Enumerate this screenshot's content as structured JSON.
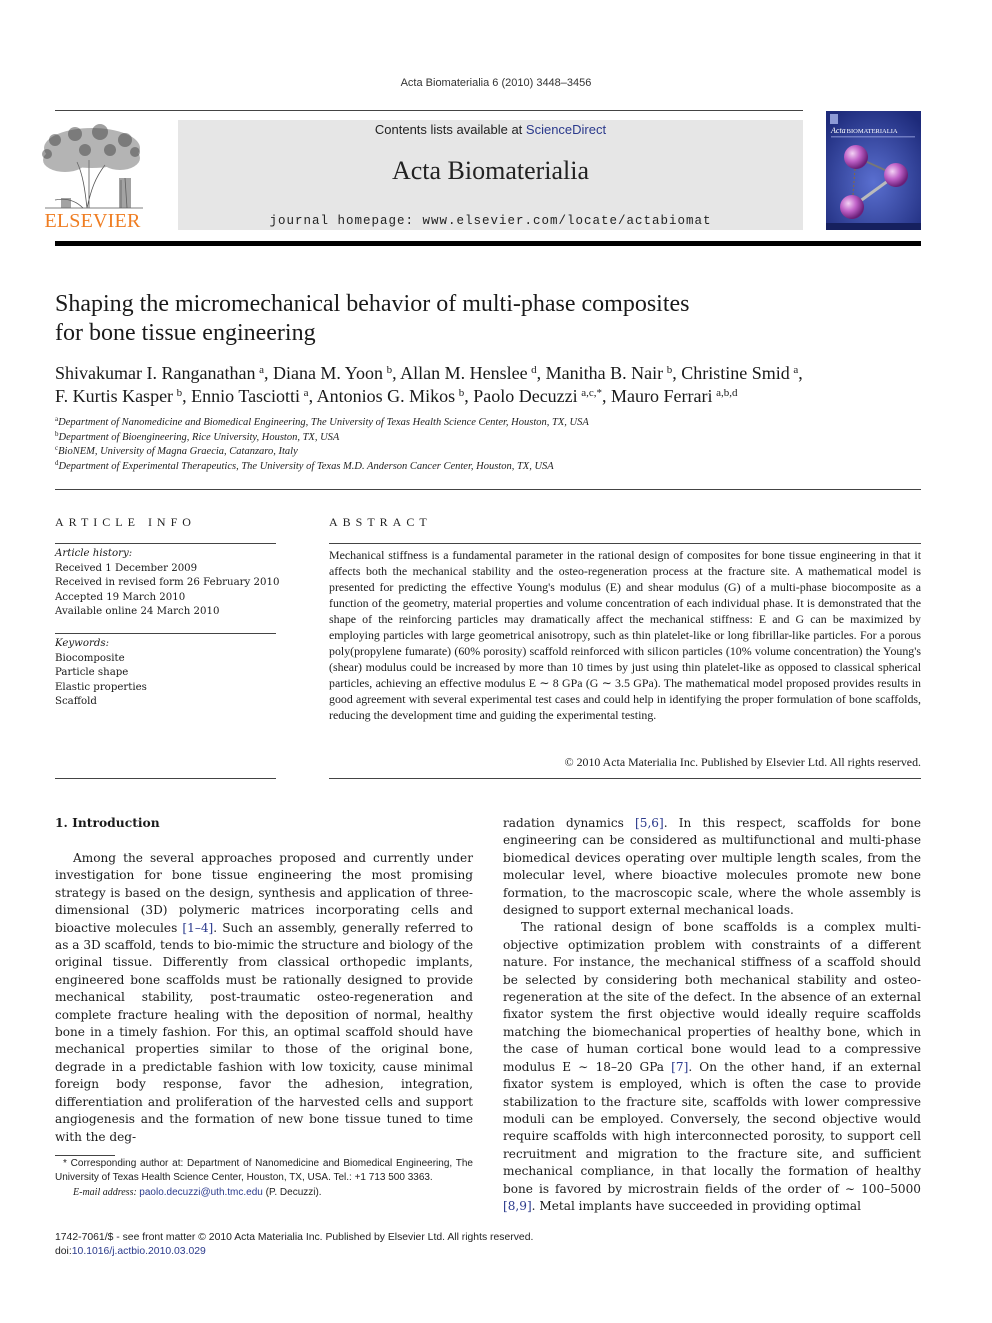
{
  "journal_ref": "Acta Biomaterialia 6 (2010) 3448–3456",
  "masthead": {
    "contents_prefix": "Contents lists available at ",
    "contents_link": "ScienceDirect",
    "journal_title": "Acta Biomaterialia",
    "homepage": "journal homepage: www.elsevier.com/locate/actabiomat",
    "publisher_wordmark": "ELSEVIER",
    "cover_title_a": "Acta",
    "cover_title_b": "BIOMATERIALIA",
    "brand_color": "#ef7d22",
    "link_color": "#2b3a8c"
  },
  "article": {
    "title_line1": "Shaping the micromechanical behavior of multi-phase composites",
    "title_line2": "for bone tissue engineering",
    "authors": [
      {
        "name": "Shivakumar I. Ranganathan",
        "aff": "a",
        "sep": ", "
      },
      {
        "name": "Diana M. Yoon",
        "aff": "b",
        "sep": ", "
      },
      {
        "name": "Allan M. Henslee",
        "aff": "d",
        "sep": ", "
      },
      {
        "name": "Manitha B. Nair",
        "aff": "b",
        "sep": ", "
      },
      {
        "name": "Christine Smid",
        "aff": "a",
        "sep": ","
      },
      {
        "name": "F. Kurtis Kasper",
        "aff": "b",
        "sep": ", "
      },
      {
        "name": "Ennio Tasciotti",
        "aff": "a",
        "sep": ", "
      },
      {
        "name": "Antonios G. Mikos",
        "aff": "b",
        "sep": ", "
      },
      {
        "name": "Paolo Decuzzi",
        "aff": "a,c,*",
        "sep": ", "
      },
      {
        "name": "Mauro Ferrari",
        "aff": "a,b,d",
        "sep": ""
      }
    ],
    "affiliations": [
      {
        "key": "a",
        "text": "Department of Nanomedicine and Biomedical Engineering, The University of Texas Health Science Center, Houston, TX, USA"
      },
      {
        "key": "b",
        "text": "Department of Bioengineering, Rice University, Houston, TX, USA"
      },
      {
        "key": "c",
        "text": "BioNEM, University of Magna Graecia, Catanzaro, Italy"
      },
      {
        "key": "d",
        "text": "Department of Experimental Therapeutics, The University of Texas M.D. Anderson Cancer Center, Houston, TX, USA"
      }
    ]
  },
  "article_info": {
    "heading": "ARTICLE INFO",
    "history_label": "Article history:",
    "history": [
      "Received 1 December 2009",
      "Received in revised form 26 February 2010",
      "Accepted 19 March 2010",
      "Available online 24 March 2010"
    ],
    "keywords_label": "Keywords:",
    "keywords": [
      "Biocomposite",
      "Particle shape",
      "Elastic properties",
      "Scaffold"
    ]
  },
  "abstract": {
    "heading": "ABSTRACT",
    "text": "Mechanical stiffness is a fundamental parameter in the rational design of composites for bone tissue engineering in that it affects both the mechanical stability and the osteo-regeneration process at the fracture site. A mathematical model is presented for predicting the effective Young's modulus (E) and shear modulus (G) of a multi-phase biocomposite as a function of the geometry, material properties and volume concentration of each individual phase. It is demonstrated that the shape of the reinforcing particles may dramatically affect the mechanical stiffness: E and G can be maximized by employing particles with large geometrical anisotropy, such as thin platelet-like or long fibrillar-like particles. For a porous poly(propylene fumarate) (60% porosity) scaffold reinforced with silicon particles (10% volume concentration) the Young's (shear) modulus could be increased by more than 10 times by just using thin platelet-like as opposed to classical spherical particles, achieving an effective modulus E ∼ 8 GPa (G ∼ 3.5 GPa). The mathematical model proposed provides results in good agreement with several experimental test cases and could help in identifying the proper formulation of bone scaffolds, reducing the development time and guiding the experimental testing.",
    "copyright": "© 2010 Acta Materialia Inc. Published by Elsevier Ltd. All rights reserved."
  },
  "introduction": {
    "heading": "1. Introduction",
    "col1": [
      {
        "before": "Among the several approaches proposed and currently under investigation for bone tissue engineering the most promising strategy is based on the design, synthesis and application of three-dimensional (3D) polymeric matrices incorporating cells and bioactive molecules ",
        "cite": "[1–4]",
        "after": ". Such an assembly, generally referred to as a 3D scaffold, tends to bio-mimic the structure and biology of the original tissue. Differently from classical orthopedic implants, engineered bone scaffolds must be rationally designed to provide mechanical stability, post-traumatic osteo-regeneration and complete fracture healing with the deposition of normal, healthy bone in a timely fashion. For this, an optimal scaffold should have mechanical properties similar to those of the original bone, degrade in a predictable fashion with low toxicity, cause minimal foreign body response, favor the adhesion, integration, differentiation and proliferation of the harvested cells and support angiogenesis and the formation of new bone tissue tuned to time with the deg-"
      }
    ],
    "col2_p1": {
      "before": "radation dynamics ",
      "cite": "[5,6]",
      "after": ". In this respect, scaffolds for bone engineering can be considered as multifunctional and multi-phase biomedical devices operating over multiple length scales, from the molecular level, where bioactive molecules promote new bone formation, to the macroscopic scale, where the whole assembly is designed to support external mechanical loads."
    },
    "col2_p2": {
      "part1": "The rational design of bone scaffolds is a complex multi-objective optimization problem with constraints of a different nature. For instance, the mechanical stiffness of a scaffold should be selected by considering both mechanical stability and osteo-regeneration at the site of the defect. In the absence of an external fixator system the first objective would ideally require scaffolds matching the biomechanical properties of healthy bone, which in the case of human cortical bone would lead to a compressive modulus E ∼ 18–20 GPa ",
      "cite1": "[7]",
      "part2": ". On the other hand, if an external fixator system is employed, which is often the case to provide stabilization to the fracture site, scaffolds with lower compressive moduli can be employed. Conversely, the second objective would require scaffolds with high interconnected porosity, to support cell recruitment and migration to the fracture site, and sufficient mechanical compliance, in that locally the formation of healthy bone is favored by microstrain fields of the order of ∼ 100–5000 ",
      "cite2": "[8,9]",
      "part3": ". Metal implants have succeeded in providing optimal"
    }
  },
  "footnote": {
    "star_text": "* Corresponding author at: Department of Nanomedicine and Biomedical Engineering, The University of Texas Health Science Center, Houston, TX, USA. Tel.: +1 713 500 3363.",
    "email_label": "E-mail address: ",
    "email": "paolo.decuzzi@uth.tmc.edu",
    "email_suffix": " (P. Decuzzi)."
  },
  "bottom": {
    "issn_line": "1742-7061/$ - see front matter © 2010 Acta Materialia Inc. Published by Elsevier Ltd. All rights reserved.",
    "doi_label": "doi:",
    "doi": "10.1016/j.actbio.2010.03.029"
  }
}
